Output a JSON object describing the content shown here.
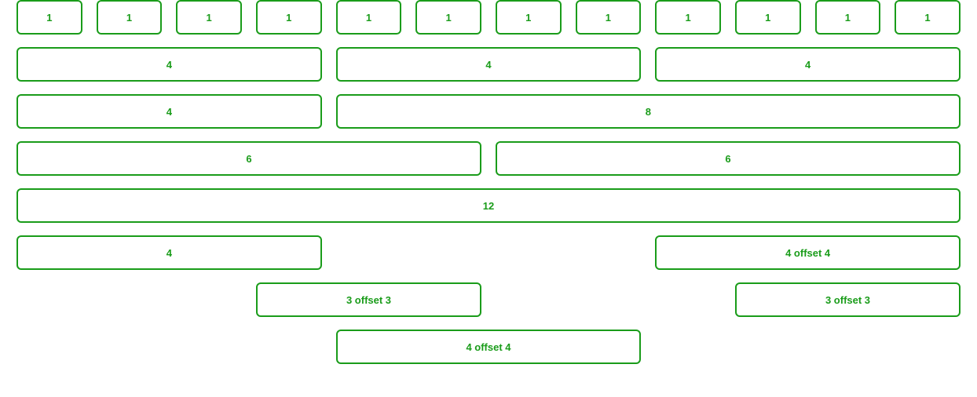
{
  "theme": {
    "border_color": "#1a9c1a",
    "text_color": "#1a9c1a",
    "background_color": "#ffffff"
  },
  "grid": {
    "total_columns": 12,
    "rows": [
      {
        "id": "row-twelve-single-columns",
        "cells": [
          {
            "label": "1",
            "span": 1,
            "offset": 0
          },
          {
            "label": "1",
            "span": 1,
            "offset": 0
          },
          {
            "label": "1",
            "span": 1,
            "offset": 0
          },
          {
            "label": "1",
            "span": 1,
            "offset": 0
          },
          {
            "label": "1",
            "span": 1,
            "offset": 0
          },
          {
            "label": "1",
            "span": 1,
            "offset": 0
          },
          {
            "label": "1",
            "span": 1,
            "offset": 0
          },
          {
            "label": "1",
            "span": 1,
            "offset": 0
          },
          {
            "label": "1",
            "span": 1,
            "offset": 0
          },
          {
            "label": "1",
            "span": 1,
            "offset": 0
          },
          {
            "label": "1",
            "span": 1,
            "offset": 0
          },
          {
            "label": "1",
            "span": 1,
            "offset": 0
          }
        ]
      },
      {
        "id": "row-three-quarter-columns",
        "cells": [
          {
            "label": "4",
            "span": 4,
            "offset": 0
          },
          {
            "label": "4",
            "span": 4,
            "offset": 0
          },
          {
            "label": "4",
            "span": 4,
            "offset": 0
          }
        ]
      },
      {
        "id": "row-four-and-eight",
        "cells": [
          {
            "label": "4",
            "span": 4,
            "offset": 0
          },
          {
            "label": "8",
            "span": 8,
            "offset": 0
          }
        ]
      },
      {
        "id": "row-two-halves",
        "cells": [
          {
            "label": "6",
            "span": 6,
            "offset": 0
          },
          {
            "label": "6",
            "span": 6,
            "offset": 0
          }
        ]
      },
      {
        "id": "row-full-width",
        "cells": [
          {
            "label": "12",
            "span": 12,
            "offset": 0
          }
        ]
      },
      {
        "id": "row-four-and-four-offset-four",
        "cells": [
          {
            "label": "4",
            "span": 4,
            "offset": 0
          },
          {
            "label": "4 offset 4",
            "span": 4,
            "offset": 4
          }
        ]
      },
      {
        "id": "row-two-three-offset-three",
        "cells": [
          {
            "label": "3 offset 3",
            "span": 3,
            "offset": 3
          },
          {
            "label": "3 offset 3",
            "span": 3,
            "offset": 3
          }
        ]
      },
      {
        "id": "row-single-four-offset-four",
        "cells": [
          {
            "label": "4 offset 4",
            "span": 4,
            "offset": 4
          }
        ]
      }
    ]
  }
}
